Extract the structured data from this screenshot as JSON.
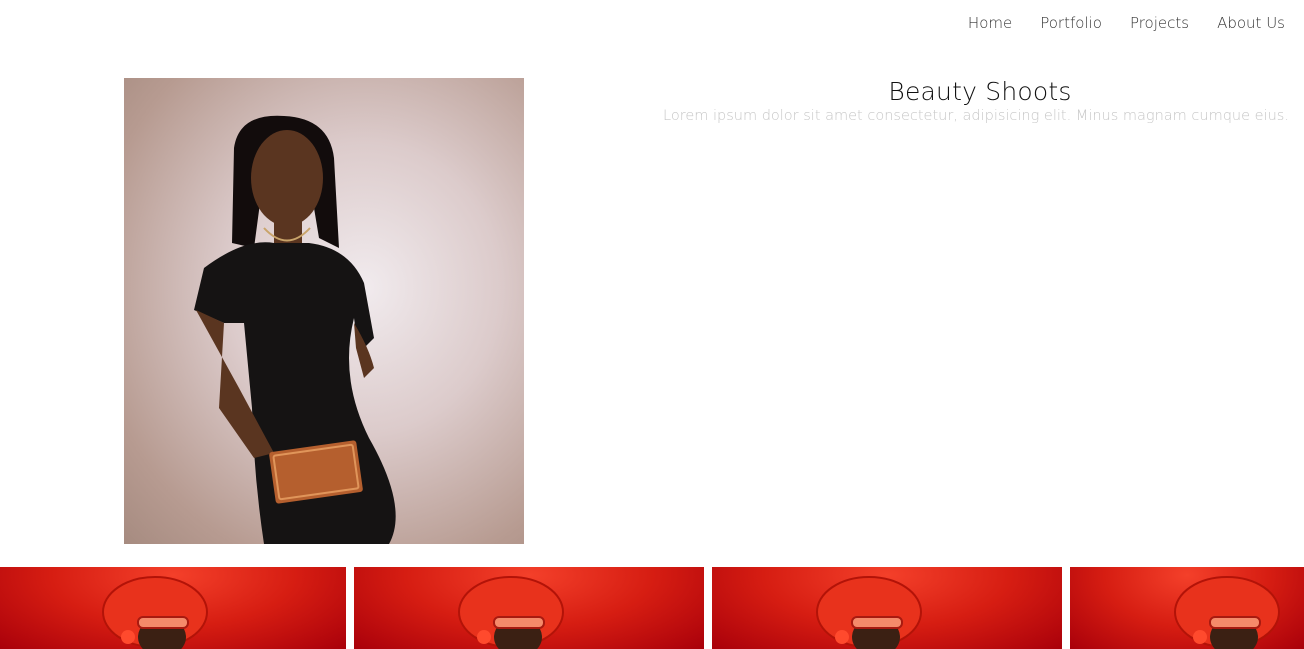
{
  "nav": {
    "items": [
      {
        "label": "Home"
      },
      {
        "label": "Portfolio"
      },
      {
        "label": "Projects"
      },
      {
        "label": "About Us"
      }
    ]
  },
  "hero": {
    "photo_icon": "portrait-photo",
    "title": "Beauty Shoots",
    "description": "Lorem ipsum dolor sit amet consectetur, adipisicing elit. Minus magnam cumque eius."
  },
  "gallery": {
    "tiles": [
      {
        "icon": "red-hat-portrait-photo"
      },
      {
        "icon": "red-hat-portrait-photo"
      },
      {
        "icon": "red-hat-portrait-photo"
      },
      {
        "icon": "red-hat-portrait-photo"
      }
    ]
  },
  "colors": {
    "nav_text": "#333333",
    "title": "#111111",
    "description": "#c7c7c7",
    "gallery_red": "#d61d12"
  }
}
